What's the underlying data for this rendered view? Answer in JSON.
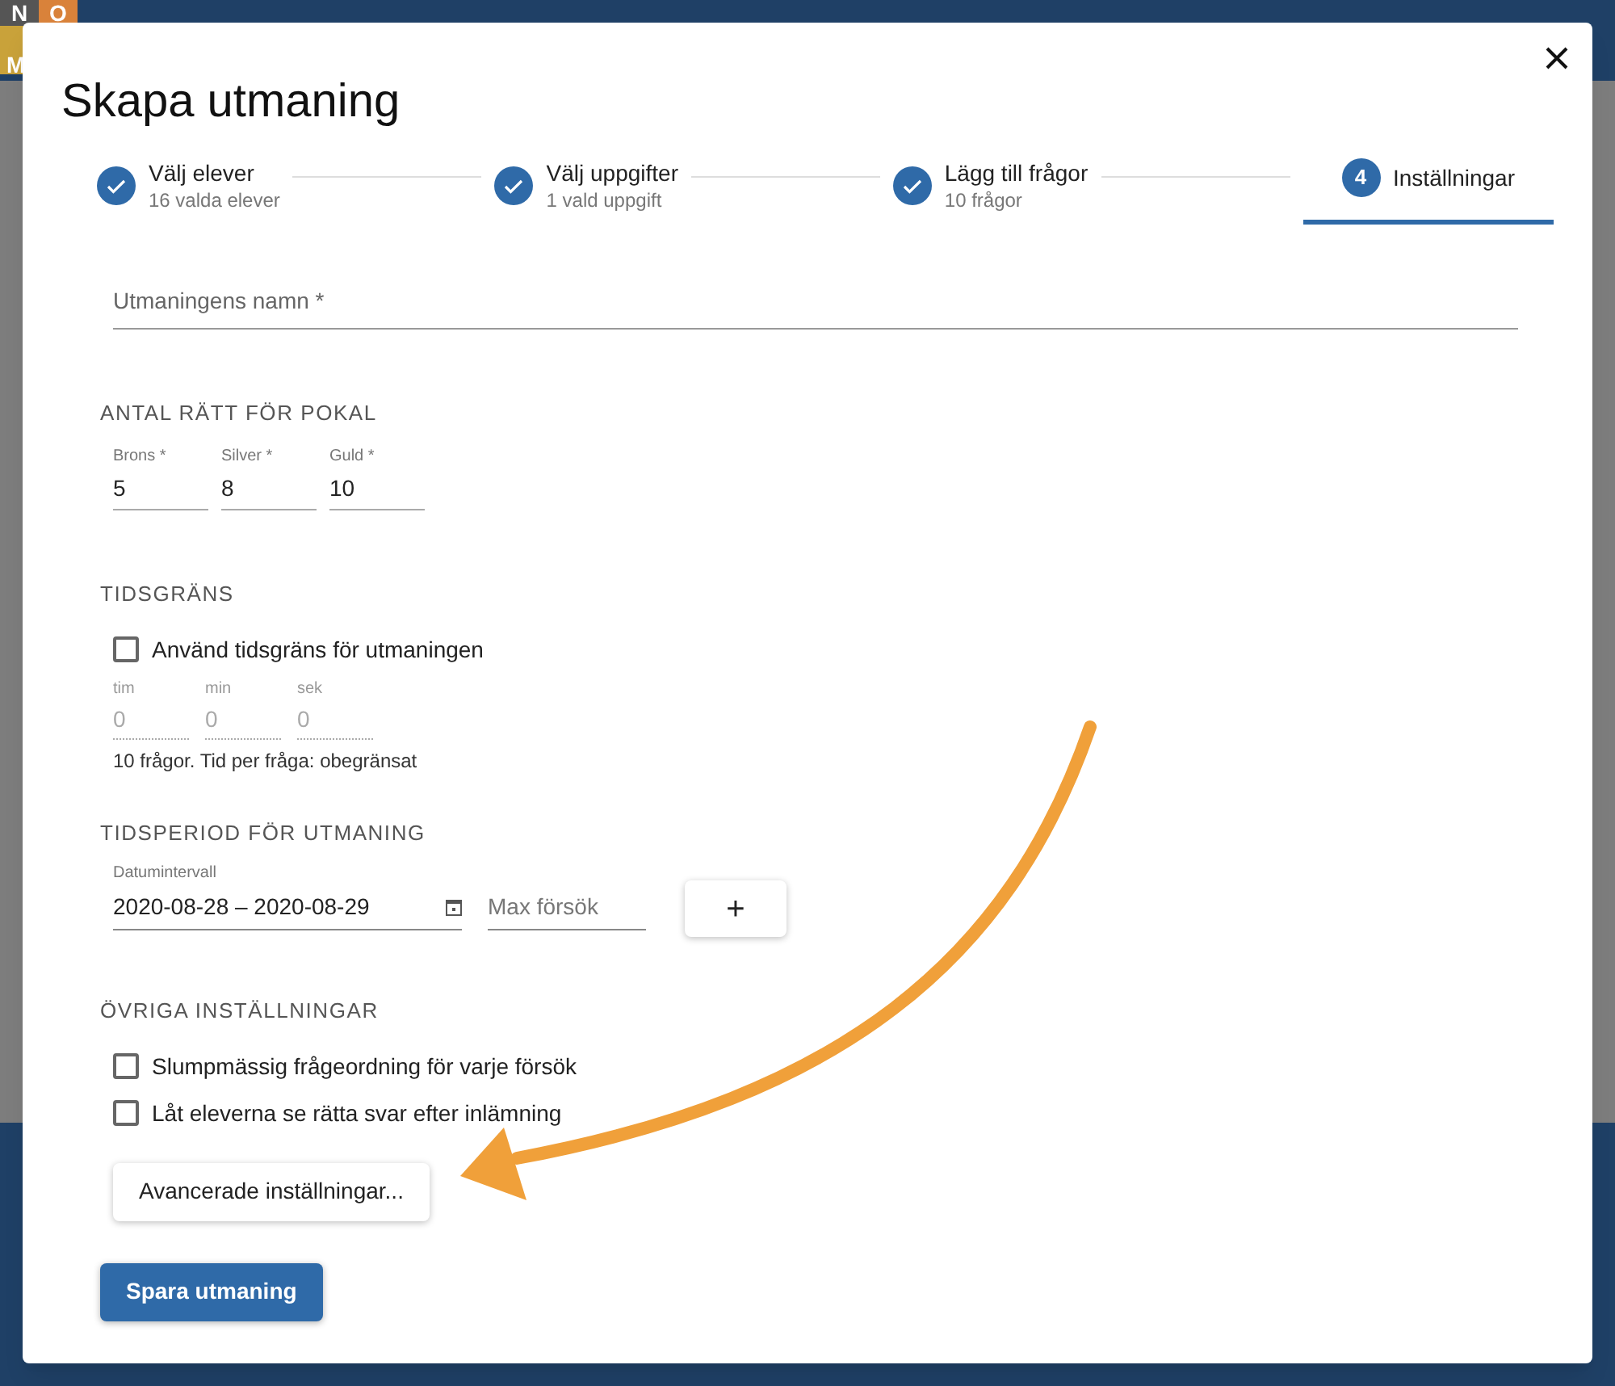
{
  "background": {
    "logo_letters": [
      "N",
      "O",
      "M"
    ]
  },
  "dialog": {
    "title": "Skapa utmaning",
    "steps": [
      {
        "label": "Välj elever",
        "sublabel": "16 valda elever",
        "completed": true
      },
      {
        "label": "Välj uppgifter",
        "sublabel": "1 vald uppgift",
        "completed": true
      },
      {
        "label": "Lägg till frågor",
        "sublabel": "10 frågor",
        "completed": true
      },
      {
        "label": "Inställningar",
        "completed": false,
        "number": "4",
        "selected": true
      }
    ],
    "name_field": {
      "placeholder": "Utmaningens namn *"
    },
    "trophy": {
      "heading": "ANTAL RÄTT FÖR POKAL",
      "fields": [
        {
          "label": "Brons *",
          "value": "5"
        },
        {
          "label": "Silver *",
          "value": "8"
        },
        {
          "label": "Guld *",
          "value": "10"
        }
      ]
    },
    "time_limit": {
      "heading": "TIDSGRÄNS",
      "checkbox": {
        "label": "Använd tidsgräns för utmaningen",
        "checked": false
      },
      "fields": [
        {
          "label": "tim",
          "placeholder": "0"
        },
        {
          "label": "min",
          "placeholder": "0"
        },
        {
          "label": "sek",
          "placeholder": "0"
        }
      ],
      "note": "10 frågor. Tid per fråga: obegränsat"
    },
    "period": {
      "heading": "TIDSPERIOD FÖR UTMANING",
      "date_field": {
        "label": "Datumintervall",
        "value": "2020-08-28 – 2020-08-29"
      },
      "attempts_field": {
        "placeholder": "Max försök"
      },
      "add_button": "+"
    },
    "other": {
      "heading": "ÖVRIGA INSTÄLLNINGAR",
      "checkboxes": [
        {
          "label": "Slumpmässig frågeordning för varje försök",
          "checked": false
        },
        {
          "label": "Låt eleverna se rätta svar efter inlämning",
          "checked": false
        }
      ]
    },
    "advanced_button": "Avancerade inställningar...",
    "save_button": "Spara utmaning"
  }
}
